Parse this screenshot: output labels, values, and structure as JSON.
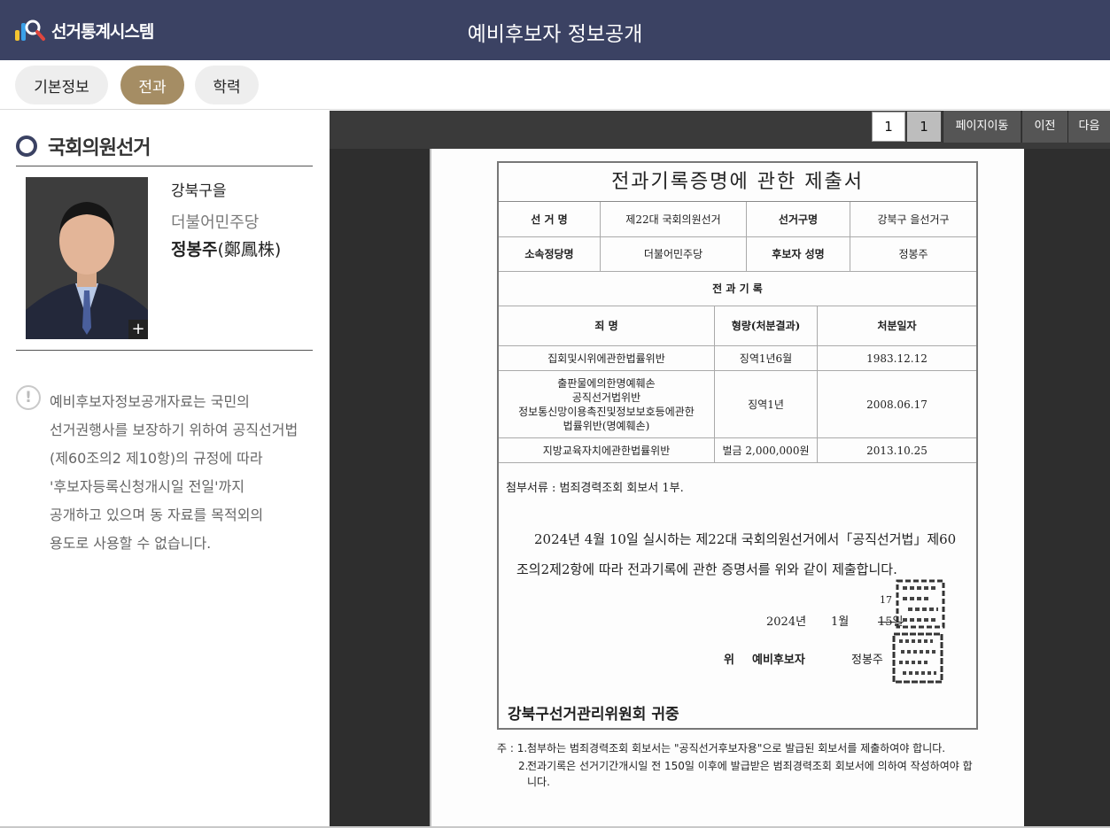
{
  "header": {
    "logo_text": "선거통계시스템",
    "title": "예비후보자 정보공개"
  },
  "tabs": [
    {
      "label": "기본정보",
      "active": false
    },
    {
      "label": "전과",
      "active": true
    },
    {
      "label": "학력",
      "active": false
    }
  ],
  "sidebar": {
    "section_title": "국회의원선거",
    "district": "강북구을",
    "party": "더불어민주당",
    "candidate_name": "정봉주",
    "candidate_hanja": "(鄭鳳株)",
    "photo_plus": "+",
    "notice_icon": "!",
    "notice_lines": [
      "예비후보자정보공개자료는 국민의",
      "선거권행사를 보장하기 위하여 공직선거법",
      "(제60조의2 제10항)의 규정에 따라",
      "'후보자등록신청개시일 전일'까지",
      "공개하고 있으며 동 자료를 목적외의",
      "용도로 사용할 수 없습니다."
    ]
  },
  "viewer": {
    "page_input": "1",
    "page_total": "1",
    "goto_label": "페이지이동",
    "prev_label": "이전",
    "next_label": "다음"
  },
  "document": {
    "title": "전과기록증명에 관한 제출서",
    "labels": {
      "election_name": "선 거 명",
      "district_name": "선거구명",
      "party_name": "소속정당명",
      "candidate_name": "후보자 성명",
      "record_header": "전 과 기 록",
      "crime": "죄 명",
      "sentence": "형량(처분결과)",
      "date": "처분일자"
    },
    "values": {
      "election_name": "제22대 국회의원선거",
      "district_name": "강북구 을선거구",
      "party_name": "더불어민주당",
      "candidate_name": "정봉주"
    },
    "records": [
      {
        "crime": [
          "집회및시위에관한법률위반"
        ],
        "sentence": "징역1년6월",
        "date": "1983.12.12"
      },
      {
        "crime": [
          "출판물에의한명예훼손",
          "공직선거법위반",
          "정보통신망이용촉진및정보보호등에관한",
          "법률위반(명예훼손)"
        ],
        "sentence": "징역1년",
        "date": "2008.06.17"
      },
      {
        "crime": [
          "지방교육자치에관한법률위반"
        ],
        "sentence": "벌금 2,000,000원",
        "date": "2013.10.25"
      }
    ],
    "attachment": "첨부서류 : 범죄경력조회 회보서 1부.",
    "body_line1": "2024년 4월 10일 실시하는 제22대 국회의원선거에서「공직선거법」제60",
    "body_line2": "조의2제2항에 따라 전과기록에 관한 증명서를 위와 같이 제출합니다.",
    "date_year": "2024년",
    "date_month": "1월",
    "date_day_struck": "15일",
    "date_day_new": "17",
    "signer_label": "위",
    "signer_role": "예비후보자",
    "signer_name": "정봉주",
    "recipient": "강북구선거관리위원회 귀중",
    "notes": [
      {
        "lead": "주 : 1.",
        "text": "첨부하는 범죄경력조회 회보서는 \"공직선거후보자용\"으로 발급된 회보서를 제출하여야 합니다."
      },
      {
        "lead": "2.",
        "text": "전과기록은 선거기간개시일 전 150일 이후에 발급받은 범죄경력조회 회보서에 의하여 작성하여야 합니다."
      }
    ]
  },
  "colors": {
    "header_bg": "#3b4263",
    "active_tab": "#a58d64",
    "viewer_bg": "#2e2e2e"
  }
}
